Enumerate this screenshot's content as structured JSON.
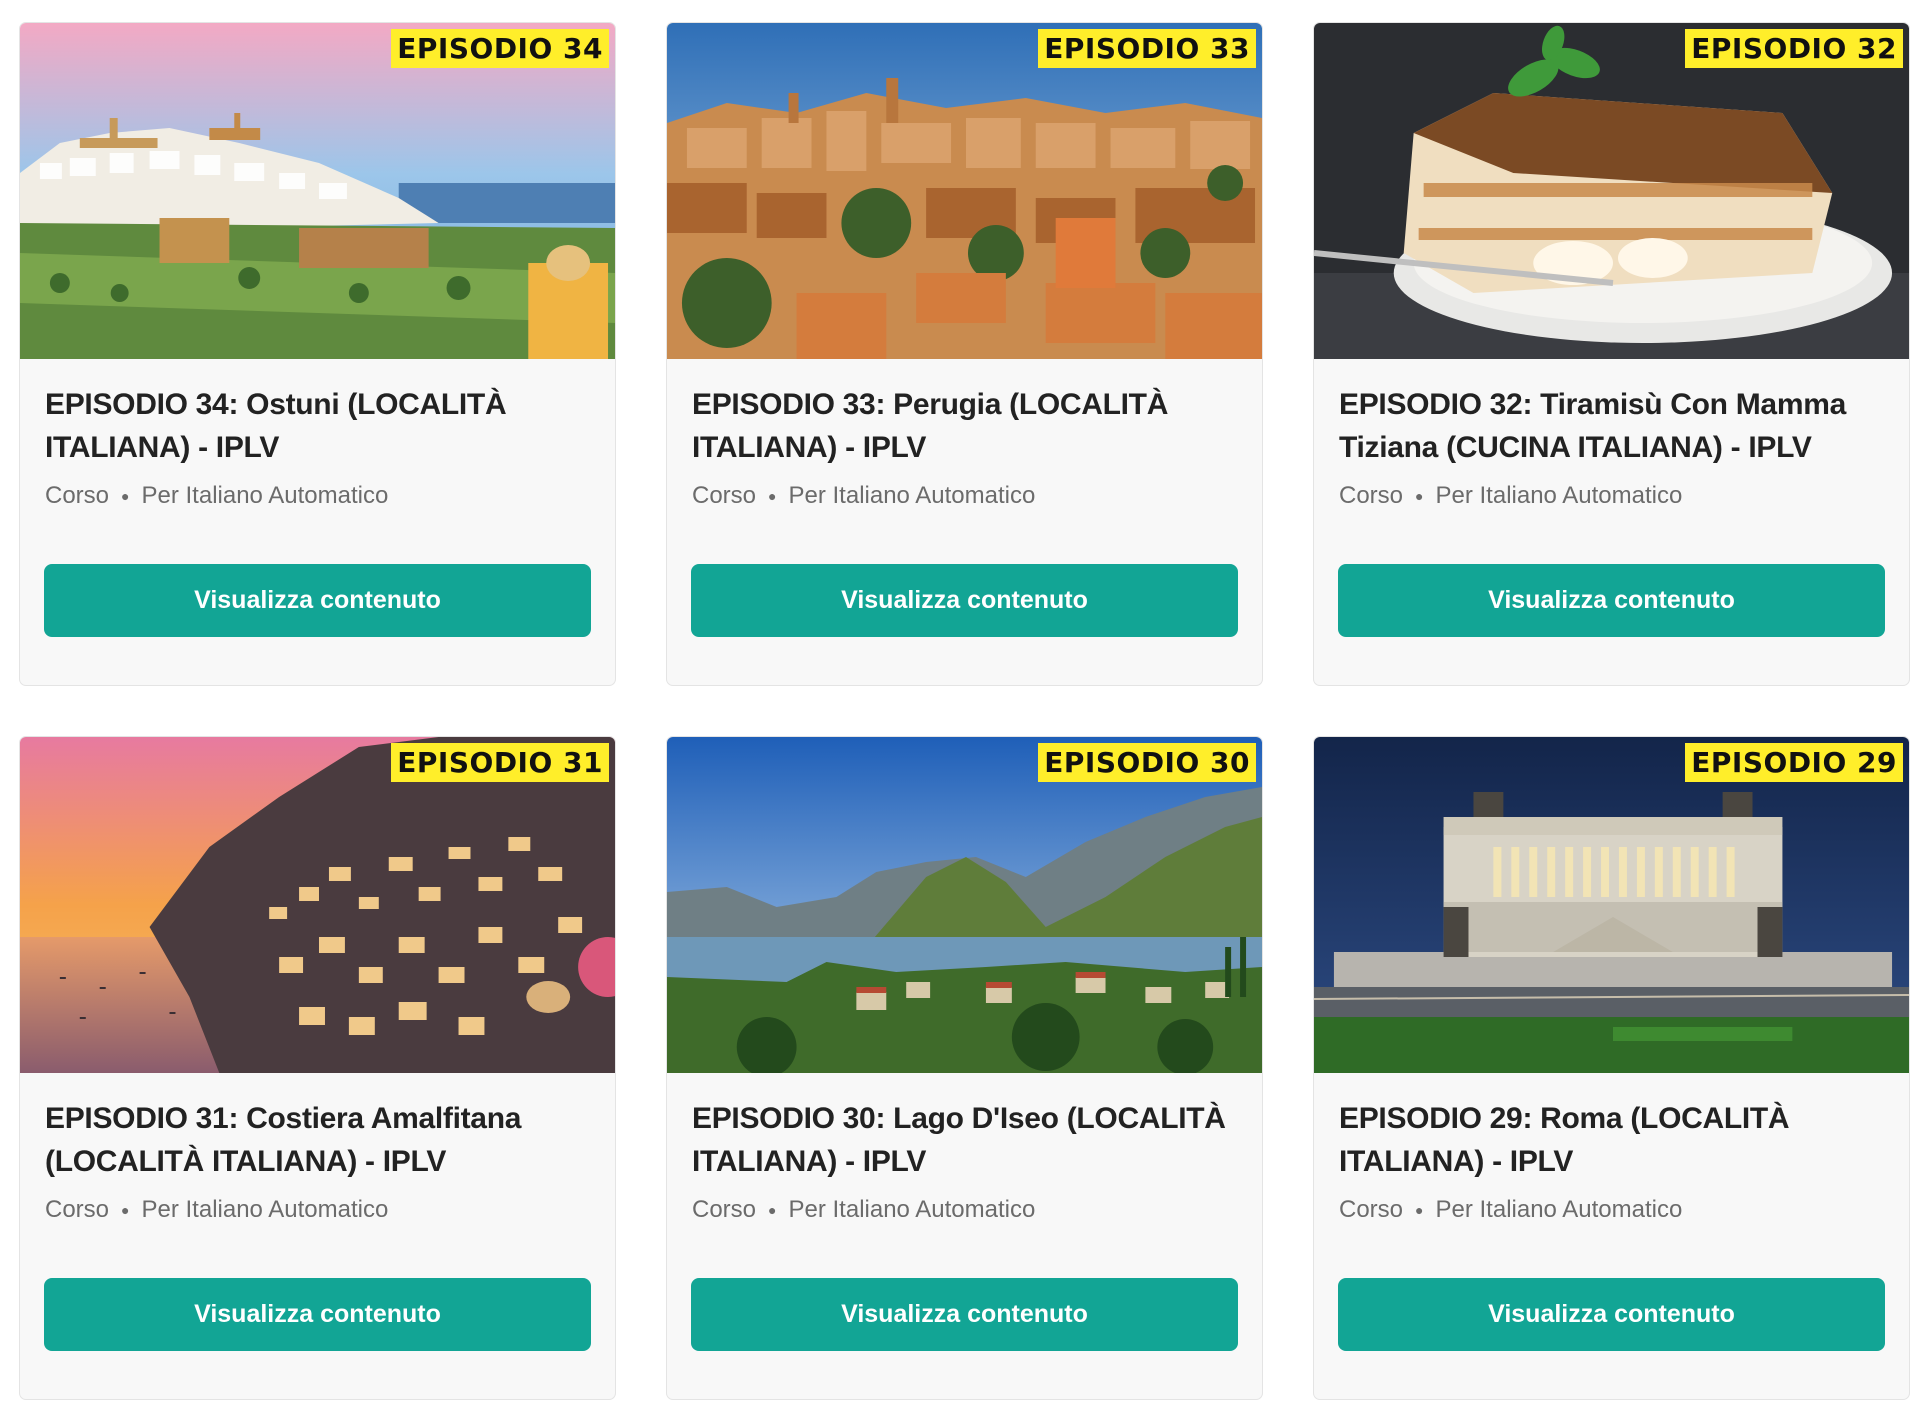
{
  "cards": [
    {
      "badge": "EPISODIO 34",
      "title": "EPISODIO 34: Ostuni (LOCALITÀ ITALIANA) - IPLV",
      "type": "Corso",
      "author": "Per Italiano Automatico",
      "button": "Visualizza contenuto"
    },
    {
      "badge": "EPISODIO 33",
      "title": "EPISODIO 33: Perugia (LOCALITÀ ITALIANA) - IPLV",
      "type": "Corso",
      "author": "Per Italiano Automatico",
      "button": "Visualizza contenuto"
    },
    {
      "badge": "EPISODIO 32",
      "title": "EPISODIO 32: Tiramisù Con Mamma Tiziana (CUCINA ITALIANA) - IPLV",
      "type": "Corso",
      "author": "Per Italiano Automatico",
      "button": "Visualizza contenuto"
    },
    {
      "badge": "EPISODIO 31",
      "title": "EPISODIO 31: Costiera Amalfitana (LOCALITÀ ITALIANA) - IPLV",
      "type": "Corso",
      "author": "Per Italiano Automatico",
      "button": "Visualizza contenuto"
    },
    {
      "badge": "EPISODIO 30",
      "title": "EPISODIO 30: Lago D'Iseo (LOCALITÀ ITALIANA) - IPLV",
      "type": "Corso",
      "author": "Per Italiano Automatico",
      "button": "Visualizza contenuto"
    },
    {
      "badge": "EPISODIO 29",
      "title": "EPISODIO 29: Roma (LOCALITÀ ITALIANA) - IPLV",
      "type": "Corso",
      "author": "Per Italiano Automatico",
      "button": "Visualizza contenuto"
    }
  ],
  "colors": {
    "button": "#12a595",
    "badge": "#ffee2a",
    "card_bg": "#f8f8f8"
  }
}
